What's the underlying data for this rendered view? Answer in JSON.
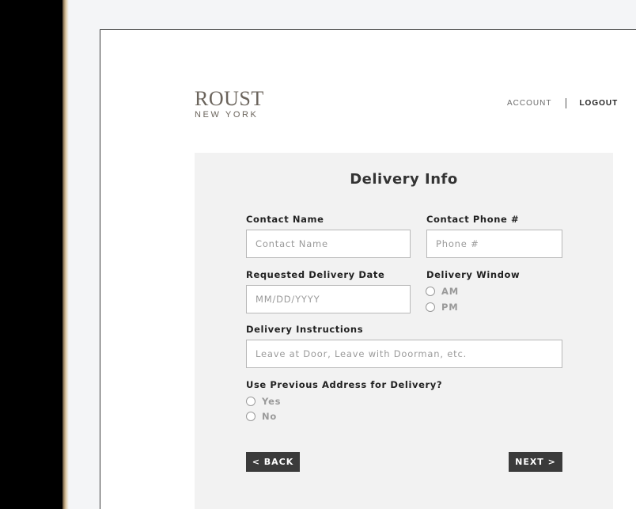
{
  "logo": {
    "main": "ROUST",
    "sub": "NEW YORK"
  },
  "nav": {
    "account": "ACCOUNT",
    "logout": "LOGOUT"
  },
  "form": {
    "title": "Delivery Info",
    "contact_name": {
      "label": "Contact Name",
      "placeholder": "Contact Name",
      "value": ""
    },
    "contact_phone": {
      "label": "Contact Phone #",
      "placeholder": "Phone #",
      "value": ""
    },
    "delivery_date": {
      "label": "Requested Delivery Date",
      "placeholder": "MM/DD/YYYY",
      "value": ""
    },
    "delivery_window": {
      "label": "Delivery Window",
      "options": [
        "AM",
        "PM"
      ],
      "selected": null
    },
    "instructions": {
      "label": "Delivery Instructions",
      "placeholder": "Leave at Door, Leave with Doorman, etc.",
      "value": ""
    },
    "previous_address": {
      "label": "Use Previous Address for Delivery?",
      "options": [
        "Yes",
        "No"
      ],
      "selected": null
    },
    "back_label": "< BACK",
    "next_label": "NEXT >"
  }
}
